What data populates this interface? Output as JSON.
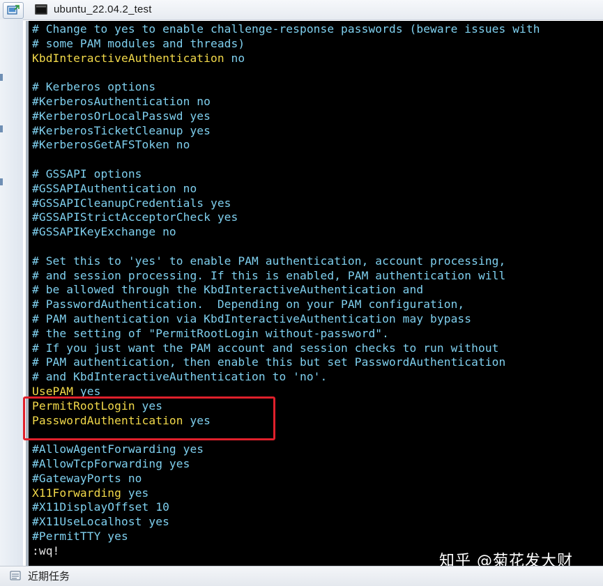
{
  "window": {
    "title": "ubuntu_22.04.2_test"
  },
  "terminal": {
    "lines": [
      {
        "key": "# Change to yes to enable challenge-response passwords (beware issues with",
        "val": "",
        "style": "comment"
      },
      {
        "key": "# some PAM modules and threads)",
        "val": "",
        "style": "comment"
      },
      {
        "key": "KbdInteractiveAuthentication",
        "val": " no",
        "style": "setting"
      },
      {
        "key": "",
        "val": "",
        "style": "comment"
      },
      {
        "key": "# Kerberos options",
        "val": "",
        "style": "comment"
      },
      {
        "key": "#KerberosAuthentication no",
        "val": "",
        "style": "comment"
      },
      {
        "key": "#KerberosOrLocalPasswd yes",
        "val": "",
        "style": "comment"
      },
      {
        "key": "#KerberosTicketCleanup yes",
        "val": "",
        "style": "comment"
      },
      {
        "key": "#KerberosGetAFSToken no",
        "val": "",
        "style": "comment"
      },
      {
        "key": "",
        "val": "",
        "style": "comment"
      },
      {
        "key": "# GSSAPI options",
        "val": "",
        "style": "comment"
      },
      {
        "key": "#GSSAPIAuthentication no",
        "val": "",
        "style": "comment"
      },
      {
        "key": "#GSSAPICleanupCredentials yes",
        "val": "",
        "style": "comment"
      },
      {
        "key": "#GSSAPIStrictAcceptorCheck yes",
        "val": "",
        "style": "comment"
      },
      {
        "key": "#GSSAPIKeyExchange no",
        "val": "",
        "style": "comment"
      },
      {
        "key": "",
        "val": "",
        "style": "comment"
      },
      {
        "key": "# Set this to 'yes' to enable PAM authentication, account processing,",
        "val": "",
        "style": "comment"
      },
      {
        "key": "# and session processing. If this is enabled, PAM authentication will",
        "val": "",
        "style": "comment"
      },
      {
        "key": "# be allowed through the KbdInteractiveAuthentication and",
        "val": "",
        "style": "comment"
      },
      {
        "key": "# PasswordAuthentication.  Depending on your PAM configuration,",
        "val": "",
        "style": "comment"
      },
      {
        "key": "# PAM authentication via KbdInteractiveAuthentication may bypass",
        "val": "",
        "style": "comment"
      },
      {
        "key": "# the setting of \"PermitRootLogin without-password\".",
        "val": "",
        "style": "comment"
      },
      {
        "key": "# If you just want the PAM account and session checks to run without",
        "val": "",
        "style": "comment"
      },
      {
        "key": "# PAM authentication, then enable this but set PasswordAuthentication",
        "val": "",
        "style": "comment"
      },
      {
        "key": "# and KbdInteractiveAuthentication to 'no'.",
        "val": "",
        "style": "comment"
      },
      {
        "key": "UsePAM",
        "val": " yes",
        "style": "setting"
      },
      {
        "key": "PermitRootLogin",
        "val": " yes",
        "style": "setting"
      },
      {
        "key": "PasswordAuthentication",
        "val": " yes",
        "style": "setting"
      },
      {
        "key": "",
        "val": "",
        "style": "comment"
      },
      {
        "key": "#AllowAgentForwarding yes",
        "val": "",
        "style": "comment"
      },
      {
        "key": "#AllowTcpForwarding yes",
        "val": "",
        "style": "comment"
      },
      {
        "key": "#GatewayPorts no",
        "val": "",
        "style": "comment"
      },
      {
        "key": "X11Forwarding",
        "val": " yes",
        "style": "setting"
      },
      {
        "key": "#X11DisplayOffset 10",
        "val": "",
        "style": "comment"
      },
      {
        "key": "#X11UseLocalhost yes",
        "val": "",
        "style": "comment"
      },
      {
        "key": "#PermitTTY yes",
        "val": "",
        "style": "comment"
      },
      {
        "key": ":wq!",
        "val": "",
        "style": "cmd"
      }
    ],
    "colors": {
      "background": "#000000",
      "comment": "#7fd0ef",
      "setting": "#f2d94a",
      "command": "#e6e6e6",
      "highlight_border": "#e0202b"
    }
  },
  "watermark": {
    "text": "知乎 @菊花发大财"
  },
  "taskbar": {
    "label": "近期任务",
    "icon": "recent-tasks-icon"
  },
  "icons": {
    "app_button": "vm-console-icon",
    "title_icon": "terminal-window-icon"
  }
}
